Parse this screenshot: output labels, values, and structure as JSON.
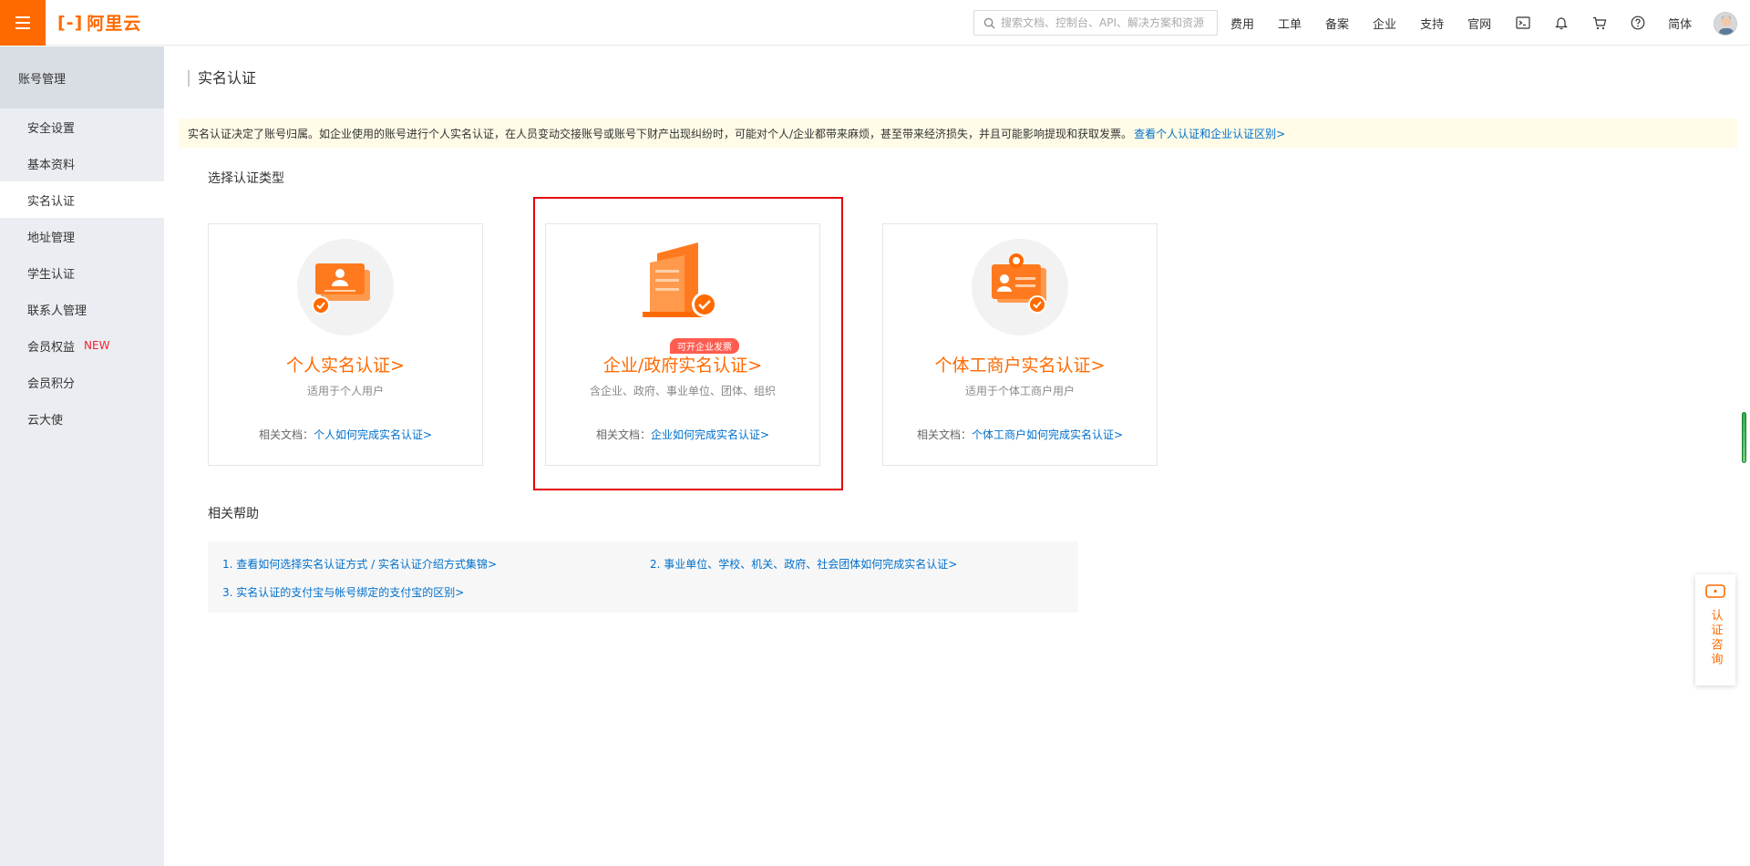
{
  "header": {
    "logo_text": "阿里云",
    "search_placeholder": "搜索文档、控制台、API、解决方案和资源",
    "nav": [
      "费用",
      "工单",
      "备案",
      "企业",
      "支持",
      "官网"
    ],
    "lang": "简体",
    "icons": [
      "terminal-icon",
      "bell-icon",
      "cart-icon",
      "help-icon"
    ]
  },
  "sidebar": {
    "title": "账号管理",
    "items": [
      {
        "label": "安全设置",
        "active": false
      },
      {
        "label": "基本资料",
        "active": false
      },
      {
        "label": "实名认证",
        "active": true
      },
      {
        "label": "地址管理",
        "active": false
      },
      {
        "label": "学生认证",
        "active": false
      },
      {
        "label": "联系人管理",
        "active": false
      },
      {
        "label": "会员权益",
        "active": false,
        "badge": "NEW"
      },
      {
        "label": "会员积分",
        "active": false
      },
      {
        "label": "云大使",
        "active": false
      }
    ]
  },
  "main": {
    "title": "实名认证",
    "notice": "实名认证决定了账号归属。如企业使用的账号进行个人实名认证，在人员变动交接账号或账号下财产出现纠纷时，可能对个人/企业都带来麻烦，甚至带来经济损失，并且可能影响提现和获取发票。",
    "notice_link": "查看个人认证和企业认证区别>",
    "choose_label": "选择认证类型",
    "cards": [
      {
        "title": "个人实名认证>",
        "subtitle": "适用于个人用户",
        "doc_prefix": "相关文档：",
        "doc_link": "个人如何完成实名认证>",
        "icon": "personal-id-icon"
      },
      {
        "title": "企业/政府实名认证>",
        "subtitle": "含企业、政府、事业单位、团体、组织",
        "doc_prefix": "相关文档：",
        "doc_link": "企业如何完成实名认证>",
        "badge": "可开企业发票",
        "icon": "enterprise-building-icon"
      },
      {
        "title": "个体工商户实名认证>",
        "subtitle": "适用于个体工商户用户",
        "doc_prefix": "相关文档：",
        "doc_link": "个体工商户如何完成实名认证>",
        "icon": "business-card-icon"
      }
    ],
    "help_label": "相关帮助",
    "help_links": [
      "1. 查看如何选择实名认证方式 / 实名认证介绍方式集锦>",
      "2. 事业单位、学校、机关、政府、社会团体如何完成实名认证>",
      "3. 实名认证的支付宝与帐号绑定的支付宝的区别>"
    ]
  },
  "float": {
    "label": "认证咨询",
    "icon": "chat-icon"
  },
  "colors": {
    "accent": "#ff6a00",
    "link": "#0070cc",
    "highlight": "#e60012",
    "notice_bg": "#fffbe6"
  }
}
